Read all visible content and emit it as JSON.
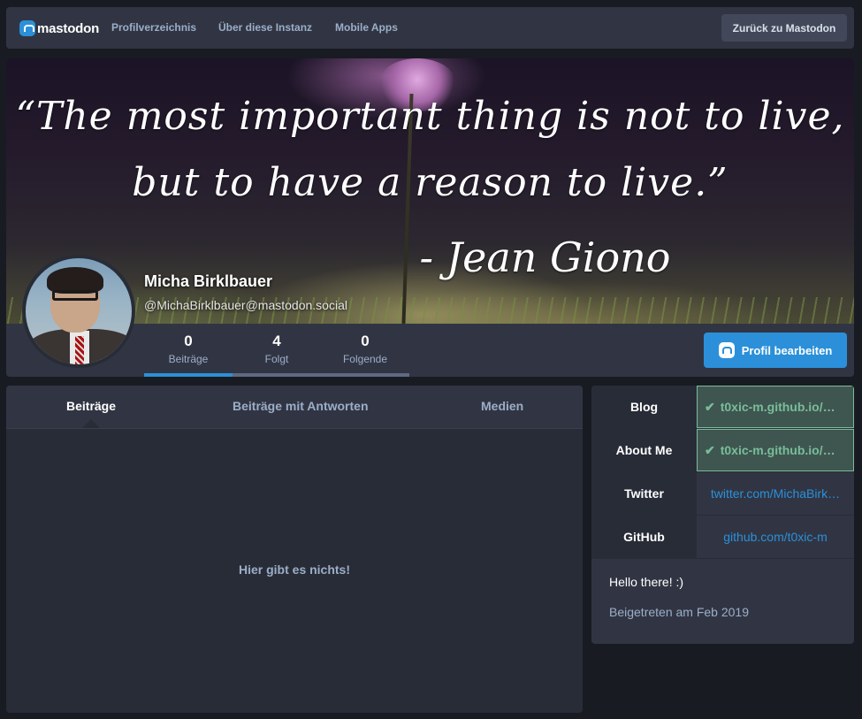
{
  "nav": {
    "logo_text": "mastodon",
    "links": [
      "Profilverzeichnis",
      "Über diese Instanz",
      "Mobile Apps"
    ],
    "back_button": "Zurück zu Mastodon"
  },
  "header": {
    "quote_line1": "“The most important thing is not to live,",
    "quote_line2": "but to have a reason to live.”",
    "quote_line3": "- Jean Giono",
    "display_name": "Micha Birklbauer",
    "account": "@MichaBirklbauer@mastodon.social",
    "edit_button": "Profil bearbeiten",
    "counters": [
      {
        "value": "0",
        "label": "Beiträge"
      },
      {
        "value": "4",
        "label": "Folgt"
      },
      {
        "value": "0",
        "label": "Folgende"
      }
    ]
  },
  "timeline": {
    "tabs": [
      "Beiträge",
      "Beiträge mit Antworten",
      "Medien"
    ],
    "empty_message": "Hier gibt es nichts!"
  },
  "fields": [
    {
      "name": "Blog",
      "value": "t0xic-m.github.io/…"
    },
    {
      "name": "About Me",
      "value": "t0xic-m.github.io/…"
    },
    {
      "name": "Twitter",
      "value": "twitter.com/MichaBirk…"
    },
    {
      "name": "GitHub",
      "value": "github.com/t0xic-m"
    }
  ],
  "bio": {
    "text": "Hello there! :)",
    "joined": "Beigetreten am Feb 2019"
  },
  "colors": {
    "accent": "#2b90d9",
    "verified": "#79bd9a",
    "background": "#191b22"
  }
}
